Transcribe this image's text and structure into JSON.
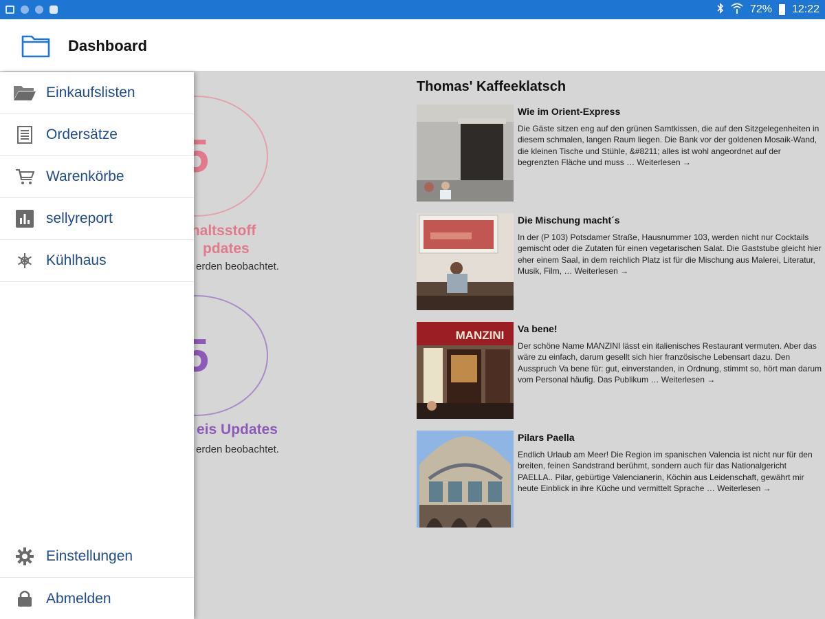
{
  "status_bar": {
    "battery": "72%",
    "time": "12:22",
    "icons": [
      "screenshot-icon",
      "notification-dot-icon",
      "notification-dot-icon",
      "image-icon",
      "bluetooth-icon",
      "wifi-icon",
      "battery-icon"
    ]
  },
  "app_bar": {
    "title": "Dashboard",
    "icon": "folder-icon"
  },
  "drawer": {
    "items": [
      {
        "label": "Einkaufslisten",
        "icon": "folder-icon"
      },
      {
        "label": "Ordersätze",
        "icon": "document-list-icon"
      },
      {
        "label": "Warenkörbe",
        "icon": "cart-icon"
      },
      {
        "label": "sellyreport",
        "icon": "bar-chart-icon"
      },
      {
        "label": "Kühlhaus",
        "icon": "snowflake-icon"
      }
    ],
    "bottom_items": [
      {
        "label": "Einstellungen",
        "icon": "gear-icon"
      },
      {
        "label": "Abmelden",
        "icon": "lock-icon"
      }
    ]
  },
  "stats": [
    {
      "number": "5",
      "title_line1": "nhaltsstoff",
      "title_line2": "pdates",
      "subtitle": "erden beobachtet.",
      "color": "#e07a8c"
    },
    {
      "number": "5",
      "title_line1": "eis Updates",
      "subtitle": "erden beobachtet.",
      "color": "#8e5ab8"
    }
  ],
  "blog": {
    "title": "Thomas' Kaffeeklatsch",
    "posts": [
      {
        "headline": "Wie im Orient-Express",
        "body": "Die Gäste sitzen eng auf den grünen Samtkissen, die auf den Sitzgelegenheiten in diesem schmalen, langen Raum liegen. Die Bank vor der goldenen Mosaik-Wand, die kleinen Tische und Stühle, &#8211; alles ist wohl angeordnet auf der begrenzten Fläche und muss … Weiterlesen →"
      },
      {
        "headline": "Die Mischung macht´s",
        "body": "In der (P 103) Potsdamer Straße, Hausnummer 103, werden nicht nur Cocktails gemischt oder die Zutaten für einen vegetarischen Salat. Die Gaststube gleicht hier eher einem Saal, in dem reichlich Platz ist für die Mischung aus Malerei, Literatur, Musik, Film,  … Weiterlesen →"
      },
      {
        "headline": "Va bene!",
        "body": "Der schöne Name MANZINI lässt ein italienisches Restaurant vermuten. Aber das wäre zu einfach, darum gesellt sich hier französische Lebensart dazu. Den Ausspruch Va bene für: gut, einverstanden, in Ordnung, stimmt so, hört man darum vom Personal häufig. Das Publikum … Weiterlesen →"
      },
      {
        "headline": "Pilars Paella",
        "body": "Endlich Urlaub am Meer! Die Region im spanischen Valencia ist nicht nur für den  breiten, feinen Sandstrand berühmt, sondern auch für das Nationalgericht PAELLA.. Pilar, gebürtige Valencianerin, Köchin aus Leidenschaft, gewährt mir heute Einblick in ihre Küche und vermittelt Sprache … Weiterlesen →"
      }
    ],
    "image_signs": {
      "post3": "MANZINI"
    }
  }
}
